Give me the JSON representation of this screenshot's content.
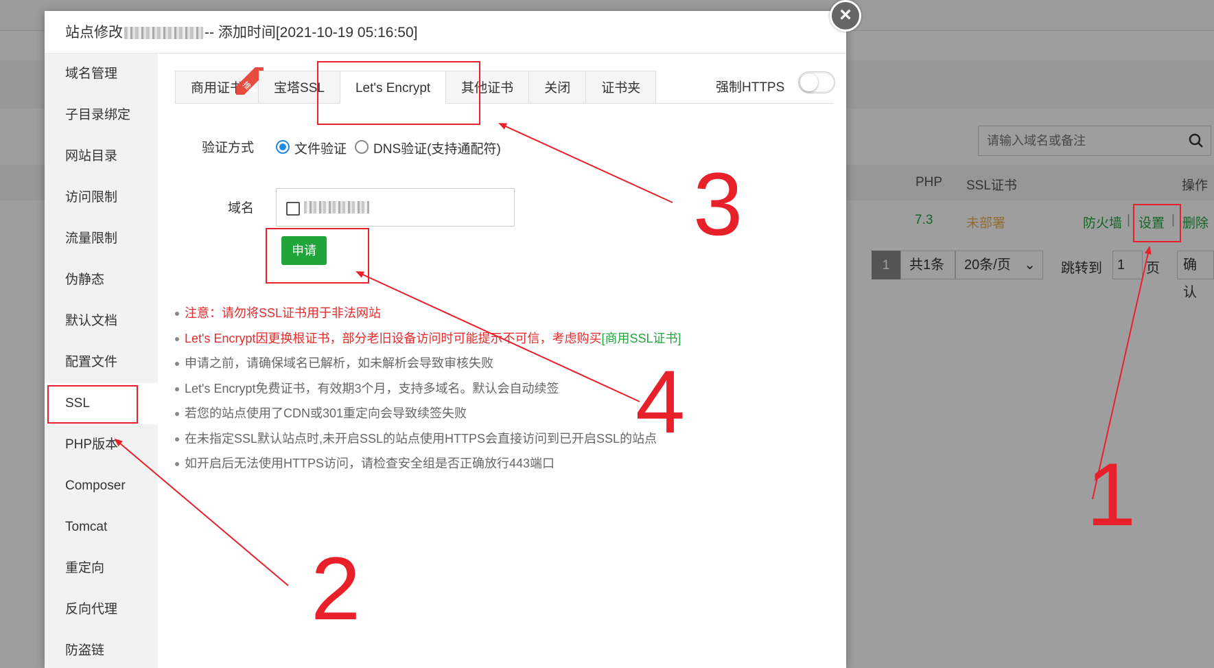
{
  "background": {
    "search_placeholder": "请输入域名或备注",
    "table_headers": {
      "php": "PHP",
      "ssl": "SSL证书",
      "actions": "操作"
    },
    "row": {
      "php": "7.3",
      "ssl": "未部署",
      "firewall": "防火墙",
      "settings": "设置",
      "delete": "删除",
      "sep": "|"
    },
    "pager": {
      "current": "1",
      "total": "共1条",
      "per_page": "20条/页",
      "jump_label": "跳转到",
      "jump_value": "1",
      "page_suffix": "页",
      "confirm": "确认"
    }
  },
  "modal": {
    "title_prefix": "站点修改",
    "title_suffix": "-- 添加时间[2021-10-19 05:16:50]",
    "close": "×"
  },
  "sidebar": {
    "items": [
      {
        "label": "域名管理"
      },
      {
        "label": "子目录绑定"
      },
      {
        "label": "网站目录"
      },
      {
        "label": "访问限制"
      },
      {
        "label": "流量限制"
      },
      {
        "label": "伪静态"
      },
      {
        "label": "默认文档"
      },
      {
        "label": "配置文件"
      },
      {
        "label": "SSL"
      },
      {
        "label": "PHP版本"
      },
      {
        "label": "Composer"
      },
      {
        "label": "Tomcat"
      },
      {
        "label": "重定向"
      },
      {
        "label": "反向代理"
      },
      {
        "label": "防盗链"
      }
    ]
  },
  "tabs": {
    "items": [
      {
        "label": "商用证书"
      },
      {
        "label": "宝塔SSL"
      },
      {
        "label": "Let's Encrypt"
      },
      {
        "label": "其他证书"
      },
      {
        "label": "关闭"
      },
      {
        "label": "证书夹"
      }
    ],
    "ribbon": "推荐",
    "force_https": "强制HTTPS"
  },
  "form": {
    "verify_label": "验证方式",
    "file_verify": "文件验证",
    "dns_verify": "DNS验证(支持通配符)",
    "domain_label": "域名",
    "apply": "申请"
  },
  "notes": {
    "n1": "注意：请勿将SSL证书用于非法网站",
    "n2_prefix": "Let's Encrypt因更换根证书，部分老旧设备访问时可能提示不可信，考虑购买",
    "n2_link": "[商用SSL证书]",
    "n3": "申请之前，请确保域名已解析，如未解析会导致审核失败",
    "n4": "Let's Encrypt免费证书，有效期3个月，支持多域名。默认会自动续签",
    "n5": "若您的站点使用了CDN或301重定向会导致续签失败",
    "n6": "在未指定SSL默认站点时,未开启SSL的站点使用HTTPS会直接访问到已开启SSL的站点",
    "n7": "如开启后无法使用HTTPS访问，请检查安全组是否正确放行443端口"
  },
  "annotations": {
    "n1": "1",
    "n2": "2",
    "n3": "3",
    "n4": "4"
  }
}
